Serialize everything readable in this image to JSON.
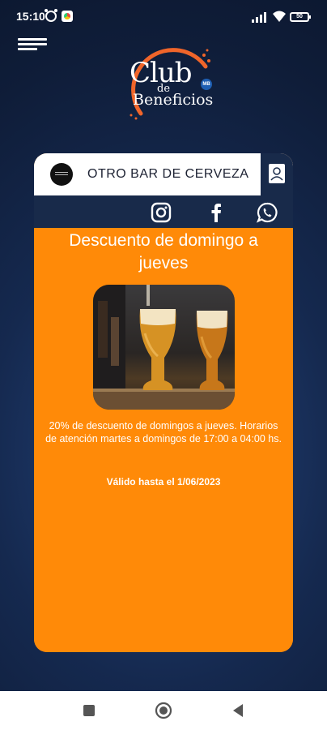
{
  "status_bar": {
    "time": "15:10",
    "battery": "50"
  },
  "logo": {
    "line1": "Club",
    "line2": "de",
    "line3": "Beneficios",
    "badge": "MB"
  },
  "card": {
    "store_name": "OTRO BAR DE CERVEZA",
    "social_icons": [
      "instagram-icon",
      "facebook-icon",
      "whatsapp-icon"
    ],
    "promo_title": "Descuento de domingo a jueves",
    "promo_description": "20% de descuento de domingos a jueves. Horarios de atención martes a domingos de 17:00 a 04:00 hs.",
    "promo_validity": "Válido hasta el 1/06/2023",
    "accent_color": "#ff8a08",
    "dark_color": "#182a4a"
  },
  "nav_bar": {
    "buttons": [
      "recents-icon",
      "home-icon",
      "back-icon"
    ]
  }
}
